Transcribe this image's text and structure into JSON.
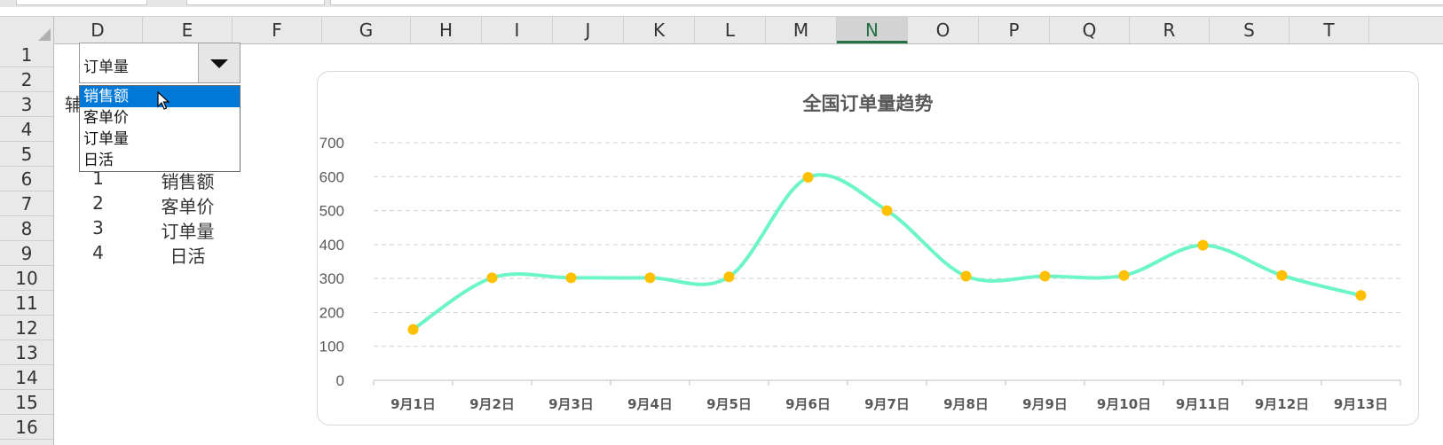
{
  "sheet": {
    "columns": [
      "D",
      "E",
      "F",
      "G",
      "H",
      "I",
      "J",
      "K",
      "L",
      "M",
      "N",
      "O",
      "P",
      "Q",
      "R",
      "S",
      "T"
    ],
    "selected_column": "N",
    "rows": [
      "1",
      "2",
      "3",
      "4",
      "5",
      "6",
      "7",
      "8",
      "9",
      "10",
      "11",
      "12",
      "13",
      "14",
      "15",
      "16"
    ],
    "partial_cell_a3": "辅",
    "table": [
      {
        "num": "1",
        "name": "销售额"
      },
      {
        "num": "2",
        "name": "客单价"
      },
      {
        "num": "3",
        "name": "订单量"
      },
      {
        "num": "4",
        "name": "日活"
      }
    ]
  },
  "dropdown": {
    "value": "订单量",
    "options": [
      "销售额",
      "客单价",
      "订单量",
      "日活"
    ],
    "highlighted": "销售额"
  },
  "colors": {
    "line": "#6cf5c9",
    "marker": "#ffc000",
    "highlight": "#0078d7",
    "selected_col_text": "#217346"
  },
  "chart_data": {
    "type": "line",
    "title": "全国订单量趋势",
    "categories": [
      "9月1日",
      "9月2日",
      "9月3日",
      "9月4日",
      "9月5日",
      "9月6日",
      "9月7日",
      "9月8日",
      "9月9日",
      "9月10日",
      "9月11日",
      "9月12日",
      "9月13日"
    ],
    "values": [
      150,
      302,
      302,
      302,
      305,
      598,
      500,
      307,
      307,
      309,
      398,
      309,
      250
    ],
    "ylim": [
      0,
      700
    ],
    "yticks": [
      "0",
      "100",
      "200",
      "300",
      "400",
      "500",
      "600",
      "700"
    ],
    "smooth": true,
    "grid": true,
    "legend": "none"
  }
}
